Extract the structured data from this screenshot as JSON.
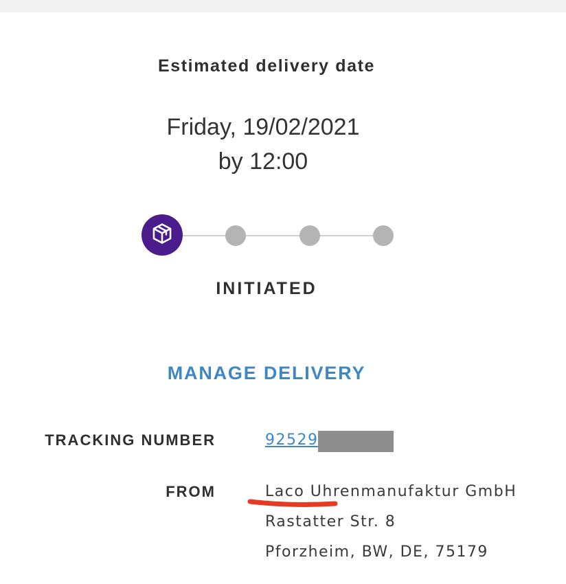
{
  "header": {
    "estimated_title": "Estimated delivery date",
    "date_line": "Friday, 19/02/2021",
    "time_line": "by 12:00"
  },
  "progress": {
    "current_step": 1,
    "total_steps": 4,
    "active_icon": "package-icon",
    "status_label": "INITIATED",
    "colors": {
      "active": "#4a1c8c",
      "inactive": "#b4b4b4",
      "line": "#cfcfcf"
    }
  },
  "actions": {
    "manage_label": "MANAGE DELIVERY",
    "link_color": "#3f87c4"
  },
  "details": {
    "tracking_label": "TRACKING NUMBER",
    "tracking_value": "92529",
    "from_label": "FROM",
    "from_lines": [
      "Laco Uhrenmanufaktur GmbH",
      "Rastatter Str. 8",
      "Pforzheim, BW, DE, 75179"
    ]
  },
  "annotation": {
    "underline_color": "#e63b22"
  }
}
